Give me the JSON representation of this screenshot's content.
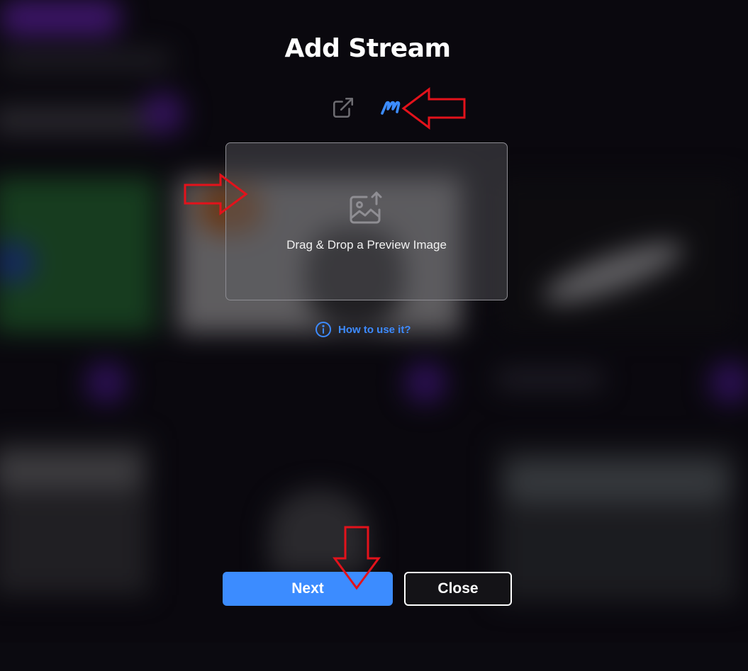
{
  "modal": {
    "title": "Add Stream",
    "sources": [
      {
        "icon": "external-link-icon"
      },
      {
        "icon": "m-logo-icon"
      }
    ],
    "dropzone_label": "Drag & Drop a Preview Image",
    "howto_label": "How to use it?",
    "next_label": "Next",
    "close_label": "Close"
  },
  "colors": {
    "accent": "#3c8cff",
    "link": "#3d8bff",
    "annotation_arrow": "#e3121b"
  }
}
